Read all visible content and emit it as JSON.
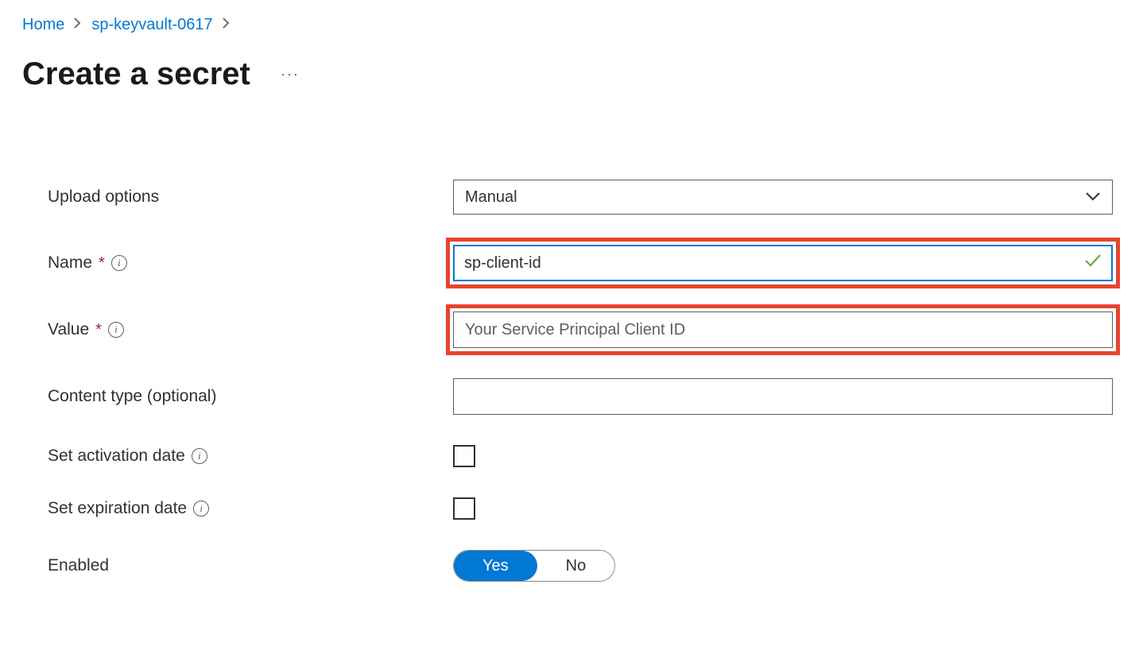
{
  "breadcrumb": {
    "home": "Home",
    "resource": "sp-keyvault-0617"
  },
  "pageTitle": "Create a secret",
  "form": {
    "uploadOptions": {
      "label": "Upload options",
      "value": "Manual"
    },
    "name": {
      "label": "Name",
      "value": "sp-client-id"
    },
    "value": {
      "label": "Value",
      "placeholder": "Your Service Principal Client ID",
      "value": ""
    },
    "contentType": {
      "label": "Content type (optional)",
      "value": ""
    },
    "activationDate": {
      "label": "Set activation date"
    },
    "expirationDate": {
      "label": "Set expiration date"
    },
    "enabled": {
      "label": "Enabled",
      "yes": "Yes",
      "no": "No"
    }
  }
}
